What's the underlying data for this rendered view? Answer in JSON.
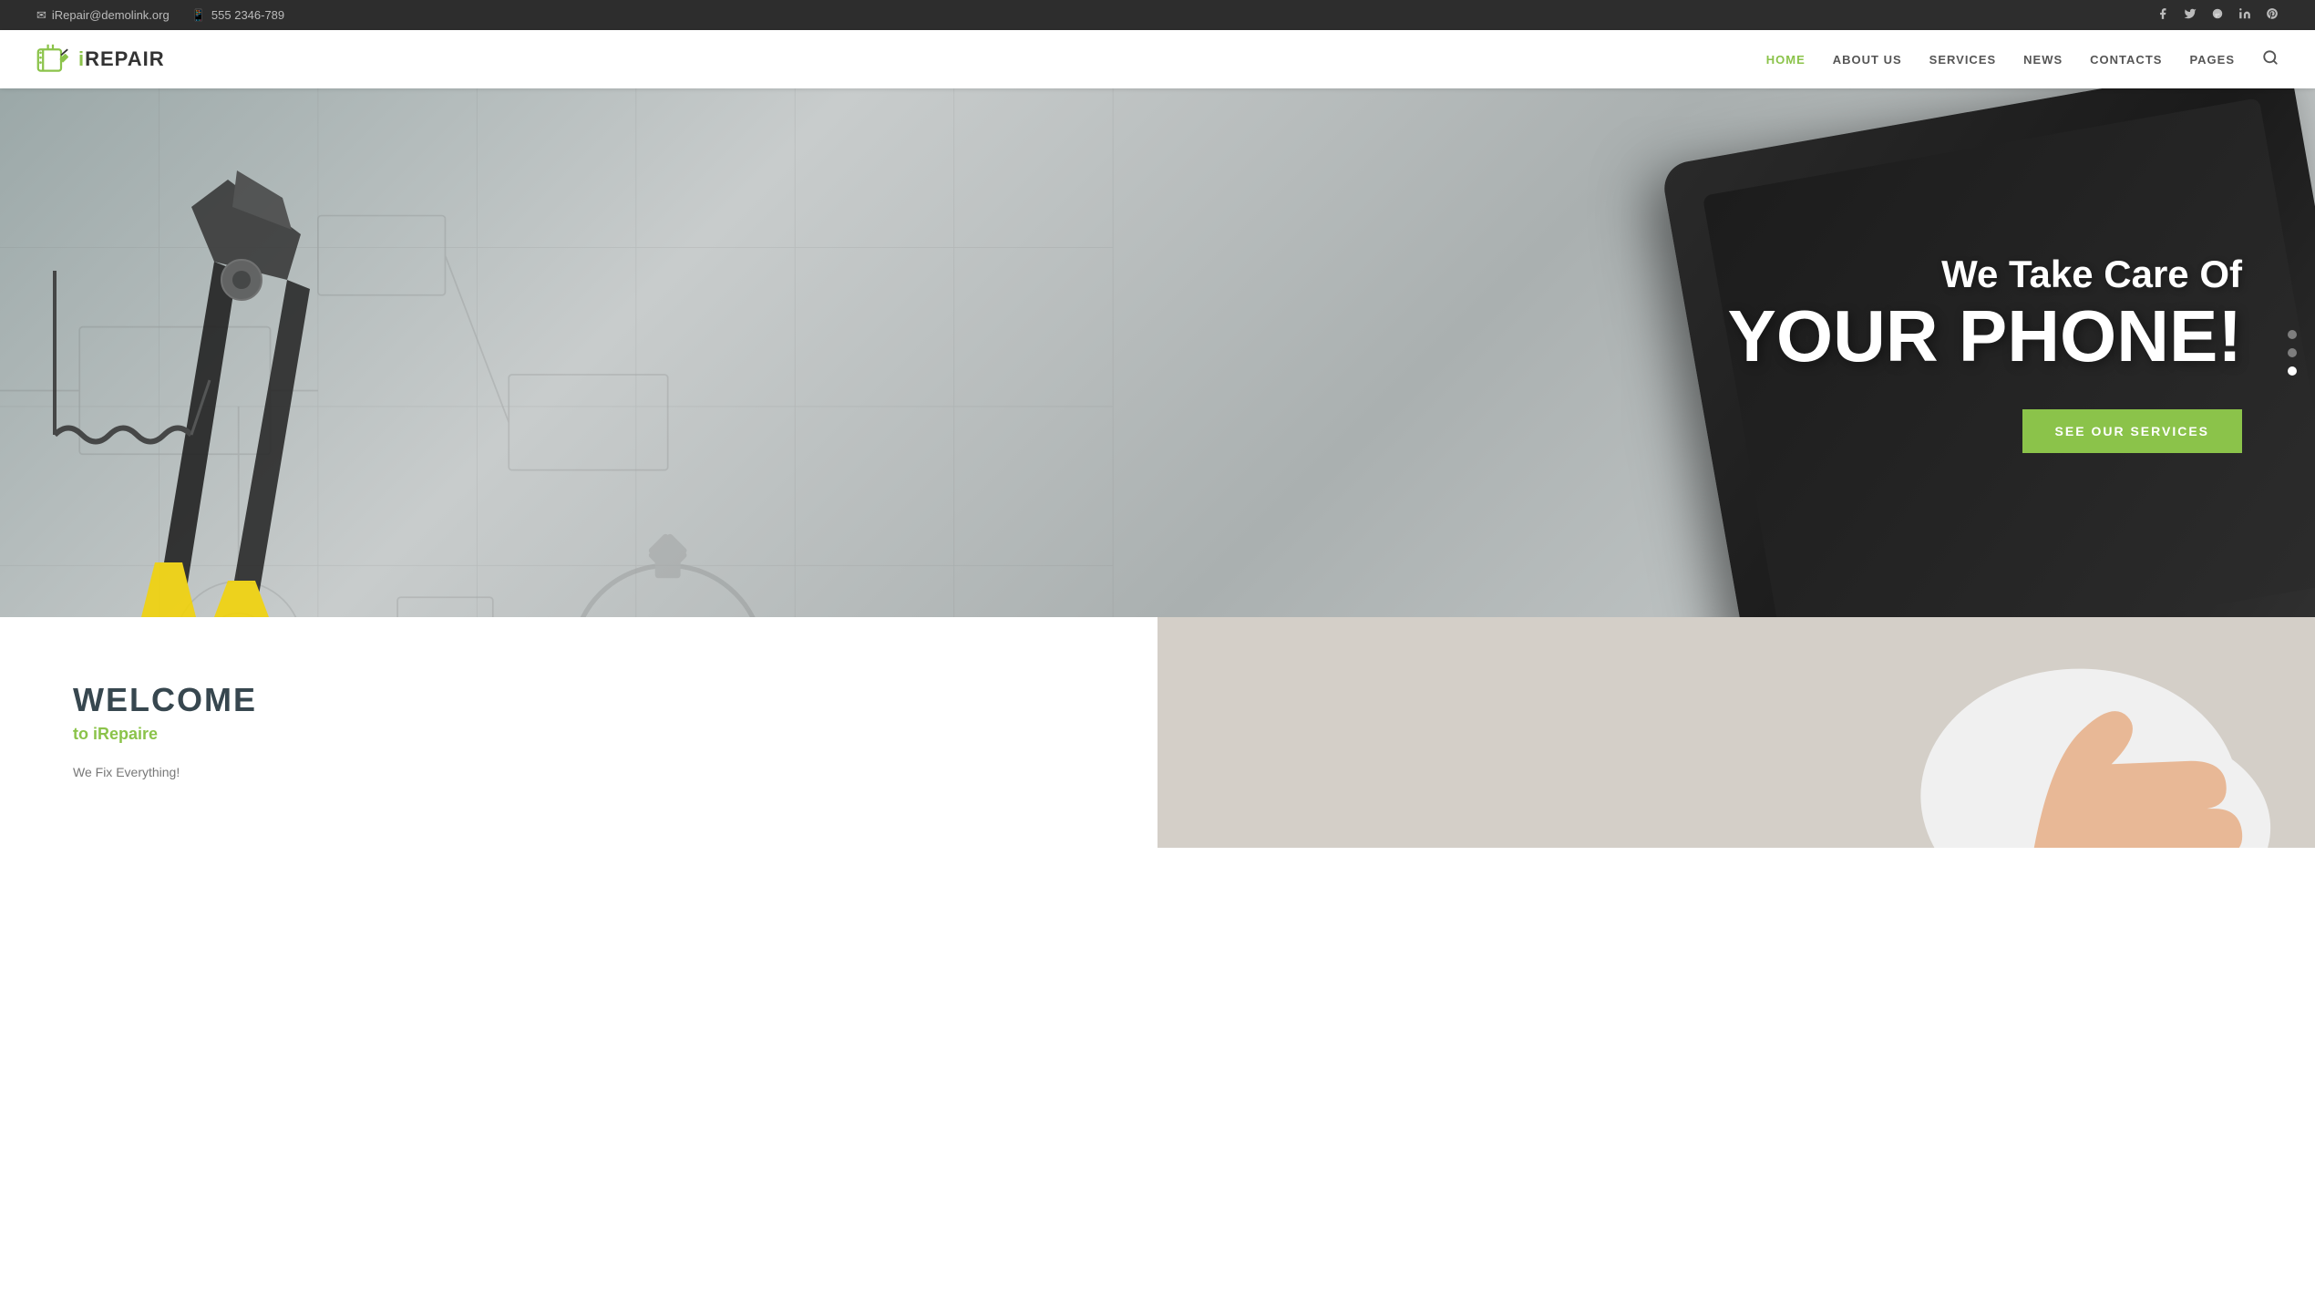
{
  "topbar": {
    "email_icon": "✉",
    "email": "iRepair@demolink.org",
    "phone_icon": "📱",
    "phone": "555 2346-789",
    "social": [
      {
        "name": "facebook",
        "icon": "f",
        "label": "Facebook"
      },
      {
        "name": "twitter",
        "icon": "t",
        "label": "Twitter"
      },
      {
        "name": "googleplus",
        "icon": "g+",
        "label": "Google Plus"
      },
      {
        "name": "linkedin",
        "icon": "in",
        "label": "LinkedIn"
      },
      {
        "name": "pinterest",
        "icon": "p",
        "label": "Pinterest"
      }
    ]
  },
  "navbar": {
    "brand": "iREPAIR",
    "brand_prefix": "i",
    "links": [
      {
        "label": "HOME",
        "active": true
      },
      {
        "label": "ABOUT US",
        "active": false
      },
      {
        "label": "SERVICES",
        "active": false
      },
      {
        "label": "NEWS",
        "active": false
      },
      {
        "label": "CONTACTS",
        "active": false
      },
      {
        "label": "PAGES",
        "active": false
      }
    ]
  },
  "hero": {
    "subtitle": "We Take Care Of",
    "title": "YOUR PHONE!",
    "cta_label": "SEE OUR SERVICES",
    "slider_dots": [
      {
        "active": false
      },
      {
        "active": false
      },
      {
        "active": true
      }
    ]
  },
  "welcome": {
    "title": "WELCOME",
    "subtitle": "to iRepaire",
    "text": "We Fix Everything!"
  }
}
